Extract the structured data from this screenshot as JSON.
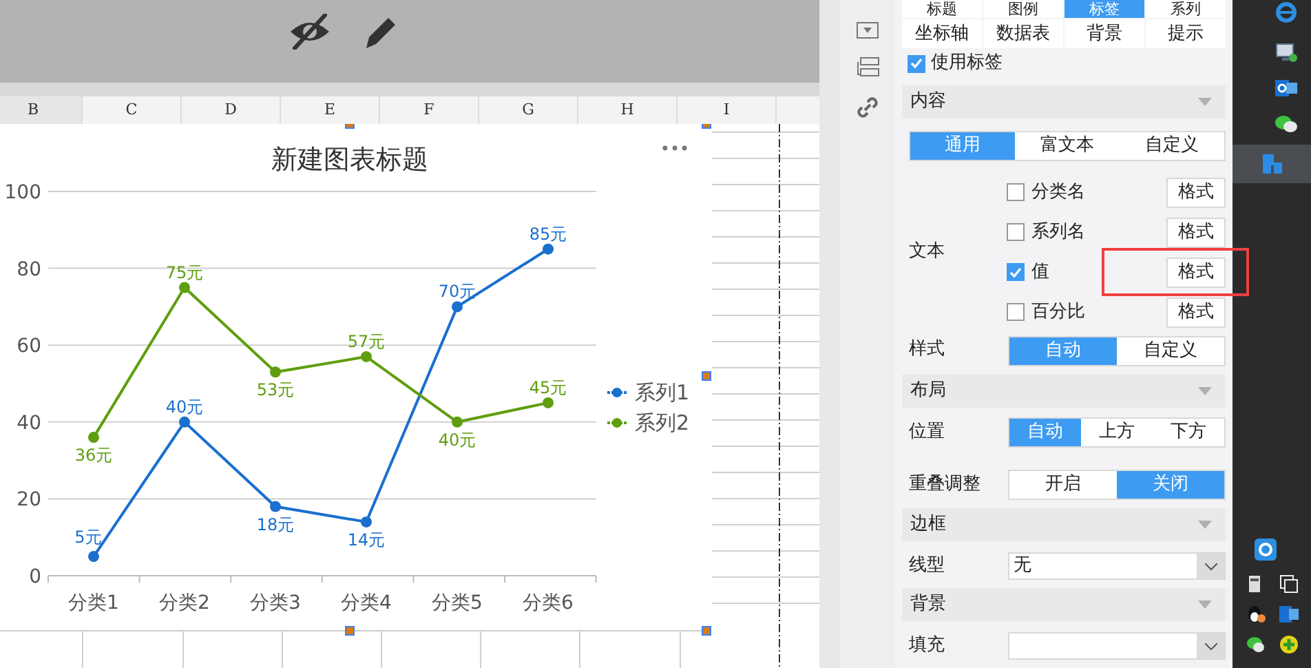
{
  "sheet": {
    "columns": [
      "B",
      "C",
      "D",
      "E",
      "F",
      "G",
      "H",
      "I"
    ]
  },
  "chart": {
    "title": "新建图表标题",
    "more": "•••",
    "chart_data": {
      "type": "line",
      "categories": [
        "分类1",
        "分类2",
        "分类3",
        "分类4",
        "分类5",
        "分类6"
      ],
      "series": [
        {
          "name": "系列1",
          "color": "#1a6fcf",
          "marker": "circle",
          "values": [
            5,
            40,
            18,
            14,
            70,
            85
          ]
        },
        {
          "name": "系列2",
          "color": "#5f9e0f",
          "marker": "circle",
          "values": [
            36,
            75,
            53,
            57,
            40,
            45
          ]
        }
      ],
      "grid": true,
      "legend": true,
      "ylim": [
        0,
        100
      ],
      "yticks": [
        0,
        20,
        40,
        60,
        80,
        100
      ],
      "value_labels": [
        [
          "5元",
          "40元",
          "18元",
          "14元",
          "70元",
          "85元"
        ],
        [
          "36元",
          "75元",
          "53元",
          "57元",
          "40元",
          "45元"
        ]
      ]
    }
  },
  "panel": {
    "tabs": [
      {
        "label": "标题",
        "selected": false
      },
      {
        "label": "图例",
        "selected": false
      },
      {
        "label": "标签",
        "selected": true
      },
      {
        "label": "系列",
        "selected": false
      },
      {
        "label": "坐标轴",
        "selected": false
      },
      {
        "label": "数据表",
        "selected": false
      },
      {
        "label": "背景",
        "selected": false
      },
      {
        "label": "提示",
        "selected": false
      }
    ],
    "use_labels": {
      "label": "使用标签",
      "checked": true
    },
    "content": {
      "header": "内容",
      "modes": [
        {
          "label": "通用",
          "selected": true
        },
        {
          "label": "富文本",
          "selected": false
        },
        {
          "label": "自定义",
          "selected": false
        }
      ],
      "text_label": "文本",
      "options": [
        {
          "label": "分类名",
          "checked": false,
          "button": "格式",
          "highlighted": false
        },
        {
          "label": "系列名",
          "checked": false,
          "button": "格式",
          "highlighted": false
        },
        {
          "label": "值",
          "checked": true,
          "button": "格式",
          "highlighted": true
        },
        {
          "label": "百分比",
          "checked": false,
          "button": "格式",
          "highlighted": false
        }
      ],
      "style_label": "样式",
      "styles": [
        {
          "label": "自动",
          "selected": true
        },
        {
          "label": "自定义",
          "selected": false
        }
      ]
    },
    "layout": {
      "header": "布局",
      "position_label": "位置",
      "positions": [
        {
          "label": "自动",
          "selected": true
        },
        {
          "label": "上方",
          "selected": false
        },
        {
          "label": "下方",
          "selected": false
        }
      ],
      "overlap_label": "重叠调整",
      "overlap": [
        {
          "label": "开启",
          "selected": false
        },
        {
          "label": "关闭",
          "selected": true
        }
      ]
    },
    "border": {
      "header": "边框",
      "line_label": "线型",
      "line_value": "无"
    },
    "background": {
      "header": "背景",
      "fill_label": "填充"
    }
  }
}
